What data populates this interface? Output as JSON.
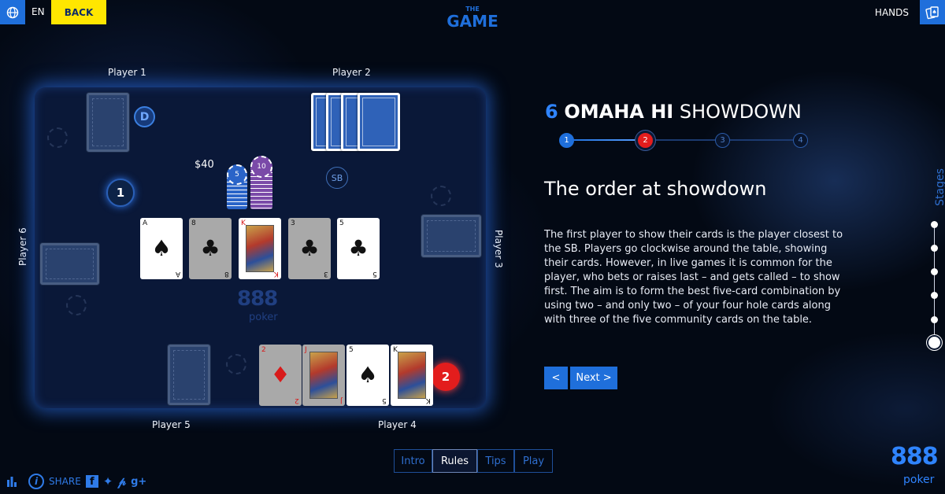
{
  "topbar": {
    "language": "EN",
    "back_label": "BACK",
    "logo_the": "THE",
    "logo_game": "GAME",
    "hands_label": "HANDS"
  },
  "players": {
    "p1": "Player 1",
    "p2": "Player 2",
    "p3": "Player 3",
    "p4": "Player 4",
    "p5": "Player 5",
    "p6": "Player 6"
  },
  "table": {
    "dealer_button": "D",
    "small_blind": "SB",
    "pot": "$40",
    "chip_values": [
      "5",
      "10"
    ],
    "seat_markers": [
      "1",
      "2"
    ],
    "watermark_888": "888",
    "watermark_poker": "poker",
    "community_cards": [
      {
        "rank": "A",
        "suit": "♠",
        "color": "black",
        "dimmed": false
      },
      {
        "rank": "8",
        "suit": "♣",
        "color": "black",
        "dimmed": true
      },
      {
        "rank": "K",
        "suit": "♦",
        "color": "red",
        "dimmed": false
      },
      {
        "rank": "3",
        "suit": "♣",
        "color": "black",
        "dimmed": true
      },
      {
        "rank": "5",
        "suit": "♣",
        "color": "black",
        "dimmed": false
      }
    ],
    "player4_cards": [
      {
        "rank": "2",
        "suit": "♦",
        "color": "red",
        "dimmed": true
      },
      {
        "rank": "J",
        "suit": "♥",
        "color": "red",
        "dimmed": true
      },
      {
        "rank": "5",
        "suit": "♠",
        "color": "black",
        "dimmed": false
      },
      {
        "rank": "K",
        "suit": "♣",
        "color": "black",
        "dimmed": false
      }
    ]
  },
  "panel": {
    "number": "6",
    "heading_bold": "OMAHA HI",
    "heading_light": "SHOWDOWN",
    "steps": [
      "1",
      "2",
      "3",
      "4"
    ],
    "current_step": 2,
    "subtitle": "The order at showdown",
    "body": "The first player to show their cards is the player closest to the SB. Players go clockwise around the table, showing their cards. However, in live games it is common for the player, who bets or raises last – and gets called – to show first. The aim is to form the best five-card combination by using two – and only two – of your four hole cards along with three of the five community cards on the table.",
    "prev_label": "<",
    "next_label": "Next  >"
  },
  "stages": {
    "label": "Stages",
    "count": 6,
    "current": 6
  },
  "tabs": [
    "Intro",
    "Rules",
    "Tips",
    "Play"
  ],
  "active_tab": "Rules",
  "footer": {
    "share_label": "SHARE",
    "social_icons": [
      "facebook-icon",
      "twitter-icon",
      "pinterest-icon",
      "google-plus-icon"
    ],
    "brand_888": "888",
    "brand_poker": "poker"
  },
  "colors": {
    "accent": "#1f6fdb",
    "back_button": "#ffe600",
    "active_red": "#e31d1d",
    "background": "#030914"
  }
}
